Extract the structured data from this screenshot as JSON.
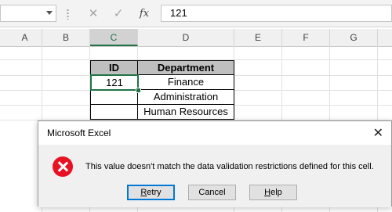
{
  "formula_bar": {
    "name_box_value": "",
    "cancel_icon": "✕",
    "enter_icon": "✓",
    "function_label": "fx",
    "formula_value": "121"
  },
  "columns": [
    "A",
    "B",
    "C",
    "D",
    "E",
    "F",
    "G"
  ],
  "selected_column": "C",
  "table": {
    "headers": [
      "ID",
      "Department"
    ],
    "rows": [
      [
        "121",
        "Finance"
      ],
      [
        "",
        "Administration"
      ],
      [
        "",
        "Human Resources"
      ]
    ]
  },
  "dialog": {
    "title": "Microsoft Excel",
    "close_icon": "✕",
    "icon": "error-icon",
    "message": "This value doesn't match the data validation restrictions defined for this cell.",
    "buttons": {
      "retry_mnemonic": "R",
      "retry_rest": "etry",
      "cancel": "Cancel",
      "help_mnemonic": "H",
      "help_rest": "elp"
    }
  },
  "colors": {
    "accent": "#217346",
    "error": "#e81123",
    "table_header_bg": "#bfbfbf"
  }
}
